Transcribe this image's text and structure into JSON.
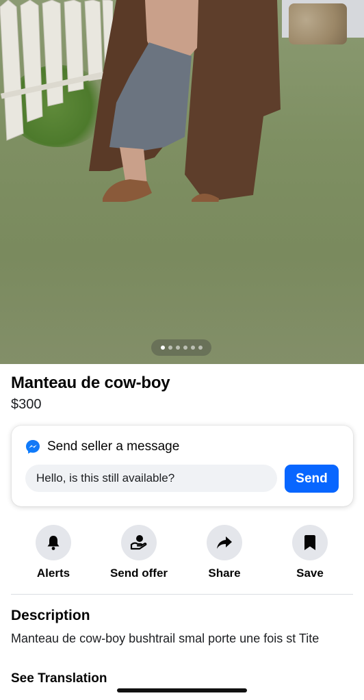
{
  "photo": {
    "pages_total": 6,
    "active_page": 1
  },
  "listing": {
    "title": "Manteau de cow-boy",
    "price": "$300"
  },
  "message_card": {
    "icon": "messenger-icon",
    "title": "Send seller a message",
    "input_value": "Hello, is this still available?",
    "send_label": "Send"
  },
  "actions": [
    {
      "label": "Alerts",
      "icon": "bell-icon"
    },
    {
      "label": "Send offer",
      "icon": "offer-icon"
    },
    {
      "label": "Share",
      "icon": "share-icon"
    },
    {
      "label": "Save",
      "icon": "bookmark-icon"
    }
  ],
  "description": {
    "heading": "Description",
    "text": "Manteau de cow-boy bushtrail smal porte une fois st Tite",
    "see_translation": "See Translation"
  },
  "colors": {
    "accent": "#0866ff",
    "icon_bg": "#e4e6eb",
    "input_bg": "#f0f2f5"
  }
}
